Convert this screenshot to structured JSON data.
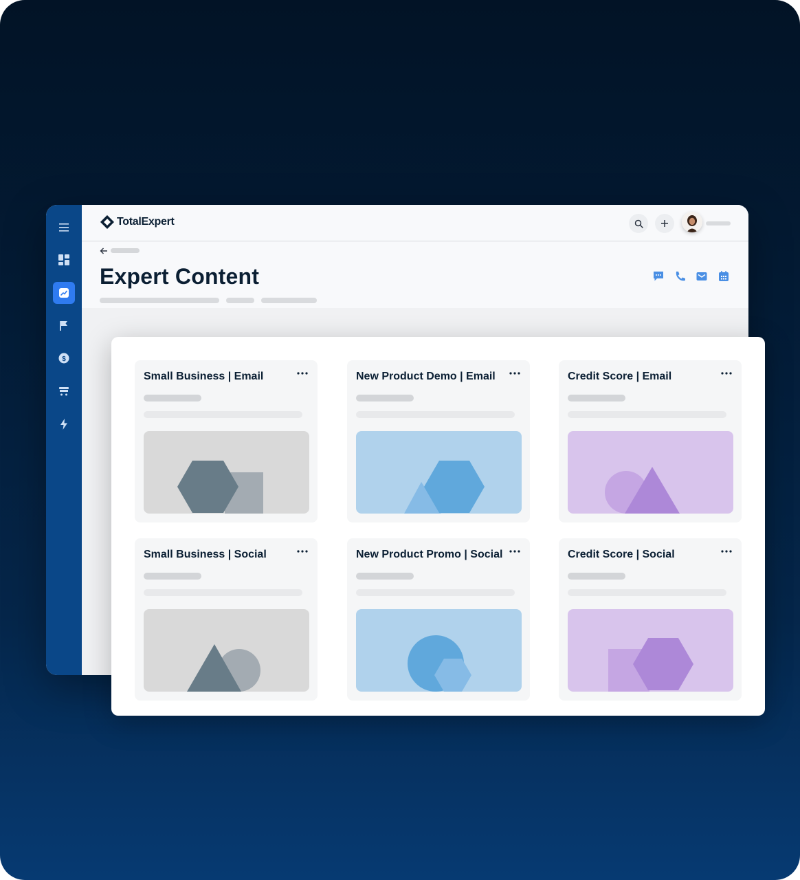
{
  "app": {
    "brand": "TotalExpert"
  },
  "page": {
    "title": "Expert Content"
  },
  "colors": {
    "sidebar": "#0a4788",
    "accent": "#2f7bf0",
    "gray_thumb": "#d9d9d9",
    "blue_thumb": "#b0d2ec",
    "purple_thumb": "#d8c4ec"
  },
  "sidebar": {
    "items": [
      {
        "icon": "menu-icon"
      },
      {
        "icon": "dashboard-icon"
      },
      {
        "icon": "trend-chart-icon",
        "active": true
      },
      {
        "icon": "flag-icon"
      },
      {
        "icon": "dollar-icon"
      },
      {
        "icon": "cart-icon"
      },
      {
        "icon": "lightning-icon"
      }
    ]
  },
  "toolbar": {
    "icons": [
      "search-icon",
      "plus-icon",
      "avatar"
    ]
  },
  "actions": [
    "chat-icon",
    "phone-icon",
    "mail-icon",
    "calendar-icon"
  ],
  "cards": [
    {
      "title": "Small Business | Email",
      "theme": "gray"
    },
    {
      "title": "New Product Demo | Email",
      "theme": "blue"
    },
    {
      "title": "Credit Score | Email",
      "theme": "purple"
    },
    {
      "title": "Small Business | Social",
      "theme": "gray"
    },
    {
      "title": "New Product Promo | Social",
      "theme": "blue"
    },
    {
      "title": "Credit Score | Social",
      "theme": "purple"
    }
  ]
}
